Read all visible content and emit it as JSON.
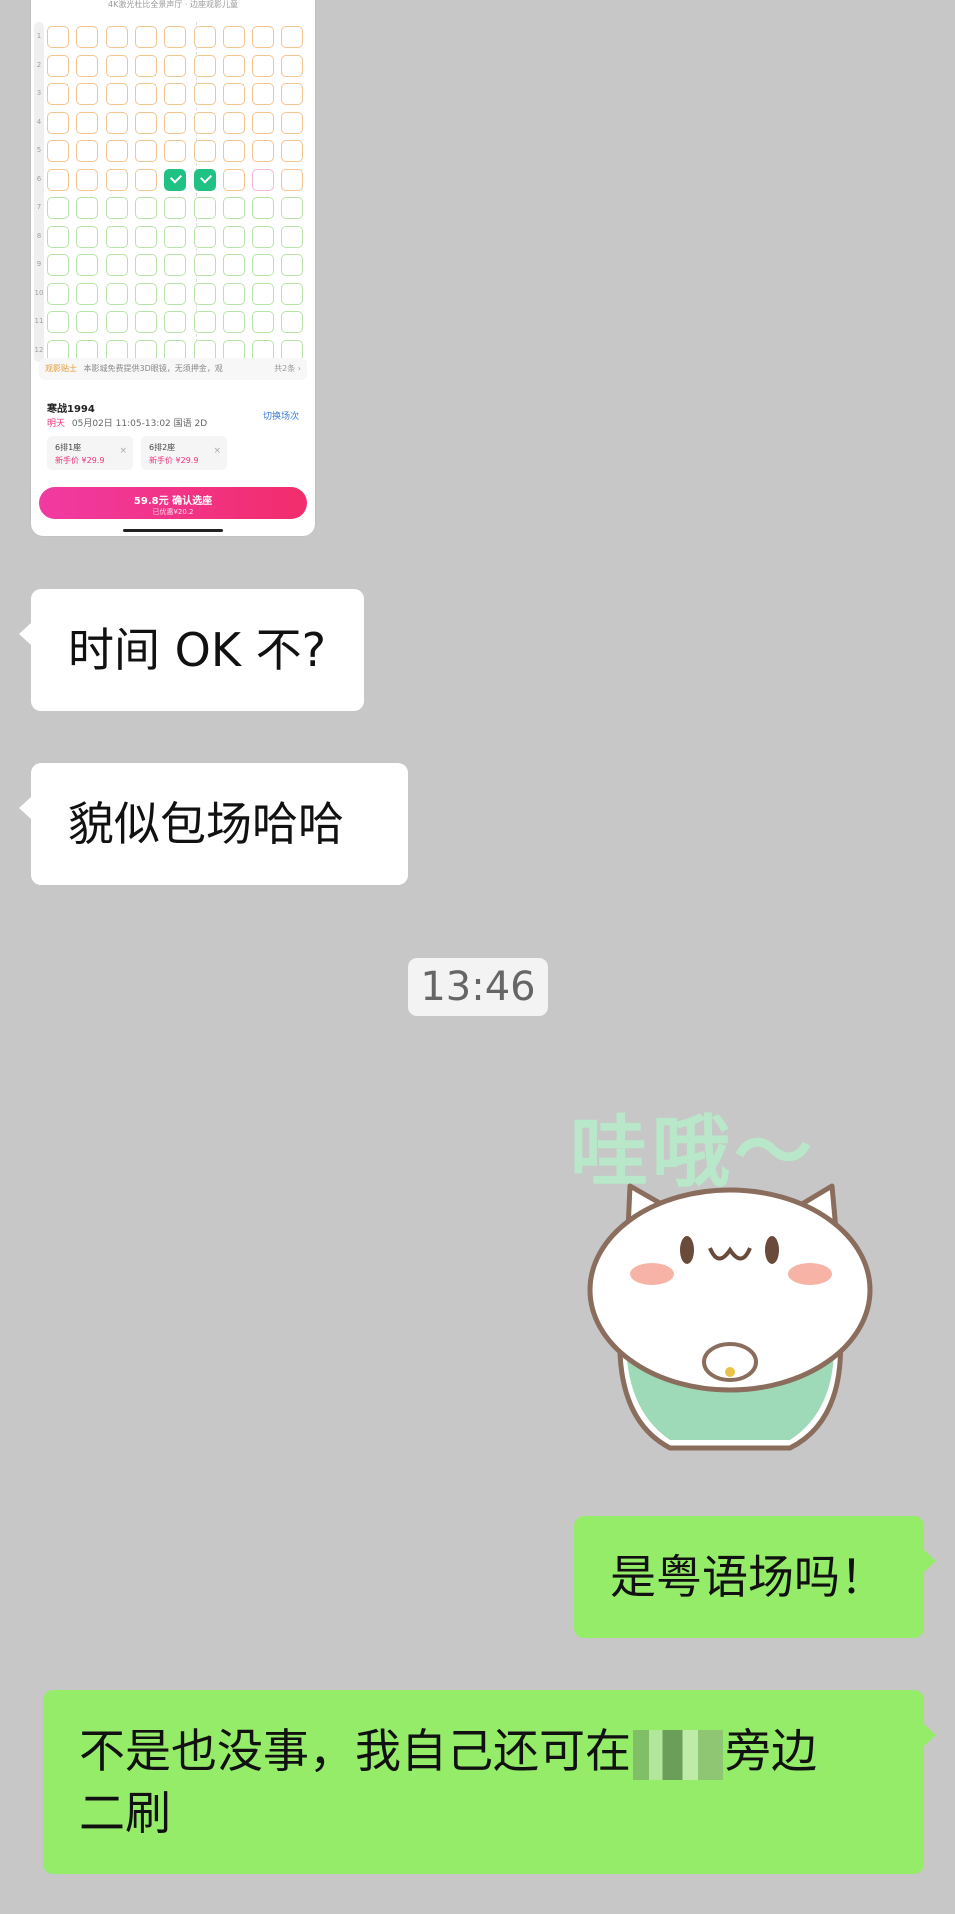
{
  "screenshot": {
    "header_text": "4K激光杜比全景声厅 · 边座观影儿童",
    "row_numbers": [
      "1",
      "2",
      "3",
      "4",
      "5",
      "6",
      "7",
      "8",
      "9",
      "10",
      "11",
      "12"
    ],
    "tip": {
      "tag": "观影贴士",
      "text": "本影城免费提供3D眼镜，无须押金，观",
      "more": "共2条 ›"
    },
    "movie": {
      "title": "寒战1994",
      "day": "明天",
      "detail": "05月02日 11:05-13:02 国语 2D",
      "switch_label": "切换场次"
    },
    "tickets": [
      {
        "seat": "6排1座",
        "price": "新手价 ¥29.9",
        "close": "×"
      },
      {
        "seat": "6排2座",
        "price": "新手价 ¥29.9",
        "close": "×"
      }
    ],
    "confirm": {
      "label": "59.8元 确认选座",
      "sub": "已优惠¥20.2"
    }
  },
  "messages": {
    "m1": "时间 OK 不?",
    "m2": "貌似包场哈哈",
    "timestamp": "13:46",
    "sticker_text": "哇哦～",
    "m3": "是粤语场吗！",
    "m4_line1_a": "不是也没事，我自己还可在",
    "m4_line1_b": "旁边",
    "m4_line2": "二刷"
  },
  "colors": {
    "background": "#c7c7c7",
    "incoming_bubble": "#ffffff",
    "outgoing_bubble": "#95ec69",
    "seat_selected": "#20c283",
    "accent_pink": "#f0357a"
  }
}
